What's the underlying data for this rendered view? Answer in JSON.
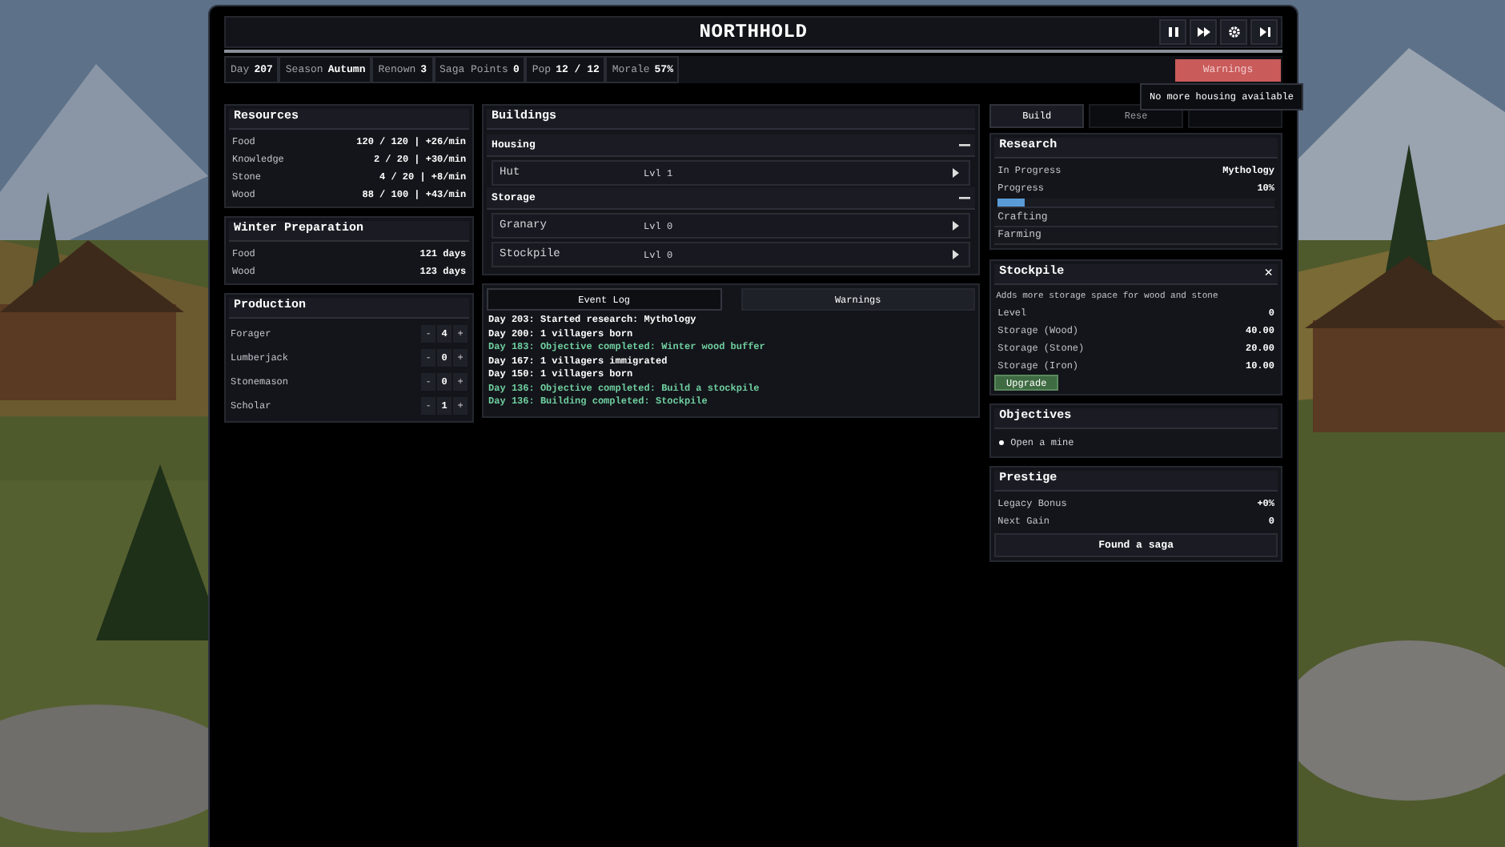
{
  "window": {
    "title": "NORTHHOLD"
  },
  "controls": [
    {
      "kind": "pause"
    },
    {
      "kind": "fast-forward"
    },
    {
      "kind": "settings"
    },
    {
      "kind": "skip"
    }
  ],
  "stats": [
    {
      "label": "Day",
      "value": "207"
    },
    {
      "label": "Season",
      "value": "Autumn"
    },
    {
      "label": "Renown",
      "value": "3"
    },
    {
      "label": "Saga Points",
      "value": "0"
    },
    {
      "label": "Pop",
      "value": "12 / 12"
    },
    {
      "label": "Morale",
      "value": "57%"
    }
  ],
  "warnings_button": {
    "label": "Warnings"
  },
  "tooltip": {
    "text": "No more housing available"
  },
  "resources": {
    "title": "Resources",
    "rows": [
      {
        "name": "Food",
        "value": "120 / 120 | +26/min"
      },
      {
        "name": "Knowledge",
        "value": "2 / 20 | +30/min"
      },
      {
        "name": "Stone",
        "value": "4 / 20 | +8/min"
      },
      {
        "name": "Wood",
        "value": "88 / 100 | +43/min"
      }
    ]
  },
  "winter": {
    "title": "Winter Preparation",
    "rows": [
      {
        "name": "Food",
        "value": "121 days"
      },
      {
        "name": "Wood",
        "value": "123 days"
      }
    ]
  },
  "production": {
    "title": "Production",
    "rows": [
      {
        "name": "Forager",
        "count": "4",
        "minus": "-",
        "plus": "+"
      },
      {
        "name": "Lumberjack",
        "count": "0",
        "minus": "-",
        "plus": "+"
      },
      {
        "name": "Stonemason",
        "count": "0",
        "minus": "-",
        "plus": "+"
      },
      {
        "name": "Scholar",
        "count": "1",
        "minus": "-",
        "plus": "+"
      }
    ]
  },
  "buildings": {
    "title": "Buildings",
    "groups": [
      {
        "name": "Housing",
        "expanded": true,
        "items": [
          {
            "name": "Hut",
            "level": "Lvl 1"
          }
        ]
      },
      {
        "name": "Storage",
        "expanded": true,
        "items": [
          {
            "name": "Granary",
            "level": "Lvl 0"
          },
          {
            "name": "Stockpile",
            "level": "Lvl 0"
          }
        ]
      }
    ]
  },
  "log": {
    "tabs": [
      {
        "label": "Event Log",
        "selected": true
      },
      {
        "label": "Warnings",
        "selected": false
      }
    ],
    "entries": [
      {
        "kind": "event",
        "text": "Day 203: Started research: Mythology"
      },
      {
        "kind": "event",
        "text": "Day 200: 1 villagers born"
      },
      {
        "kind": "objective",
        "text": "Day 183: Objective completed: Winter wood buffer"
      },
      {
        "kind": "event",
        "text": "Day 167: 1 villagers immigrated"
      },
      {
        "kind": "event",
        "text": "Day 150: 1 villagers born"
      },
      {
        "kind": "objective",
        "text": "Day 136: Objective completed: Build a stockpile"
      },
      {
        "kind": "objective",
        "text": "Day 136: Building completed: Stockpile"
      }
    ]
  },
  "side_tabs": [
    {
      "label": "Build",
      "selected": true
    },
    {
      "label": "Rese",
      "selected": false
    },
    {
      "selected": false
    }
  ],
  "research": {
    "title": "Research",
    "rows": [
      {
        "label": "In Progress",
        "value": "Mythology"
      },
      {
        "label": "Progress",
        "value": "10%"
      }
    ],
    "level": 0.1,
    "items": [
      "Crafting",
      "Farming"
    ]
  },
  "stockpile": {
    "title": "Stockpile",
    "close": "×",
    "description": "Adds more storage space for wood and stone",
    "rows": [
      {
        "label": "Level",
        "value": "0"
      },
      {
        "label": "Storage (Wood)",
        "value": "40.00"
      },
      {
        "label": "Storage (Stone)",
        "value": "20.00"
      },
      {
        "label": "Storage (Iron)",
        "value": "10.00"
      }
    ],
    "button": "Upgrade"
  },
  "objectives": {
    "title": "Objectives",
    "items": [
      "Open a mine"
    ]
  },
  "prestige": {
    "title": "Prestige",
    "rows": [
      {
        "label": "Legacy Bonus",
        "value": "+0%"
      },
      {
        "label": "Next Gain",
        "value": "0"
      }
    ],
    "button": "Found a saga"
  }
}
